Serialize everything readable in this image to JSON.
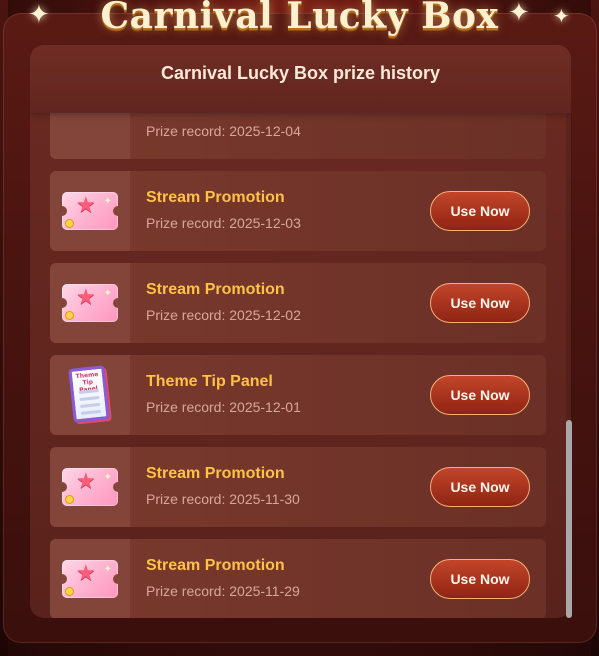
{
  "banner": {
    "title": "Carnival Lucky Box"
  },
  "dialog": {
    "header_title": "Carnival Lucky Box prize history"
  },
  "records": [
    {
      "name": "",
      "date": "Prize record: 2025-12-04",
      "icon": "purple-gift-icon",
      "button": ""
    },
    {
      "name": "Stream Promotion",
      "date": "Prize record: 2025-12-03",
      "icon": "stream-promotion-ticket-icon",
      "button": "Use Now"
    },
    {
      "name": "Stream Promotion",
      "date": "Prize record: 2025-12-02",
      "icon": "stream-promotion-ticket-icon",
      "button": "Use Now"
    },
    {
      "name": "Theme Tip Panel",
      "date": "Prize record: 2025-12-01",
      "icon": "theme-tip-panel-icon",
      "icon_text": "Theme Tip Panel",
      "button": "Use Now"
    },
    {
      "name": "Stream Promotion",
      "date": "Prize record: 2025-11-30",
      "icon": "stream-promotion-ticket-icon",
      "button": "Use Now"
    },
    {
      "name": "Stream Promotion",
      "date": "Prize record: 2025-11-29",
      "icon": "stream-promotion-ticket-icon",
      "button": "Use Now"
    }
  ],
  "colors": {
    "prize_name": "#ffc247",
    "prize_date": "#d9a79a",
    "button_bg": "#c2452a",
    "panel_bg": "#5a1a14"
  }
}
